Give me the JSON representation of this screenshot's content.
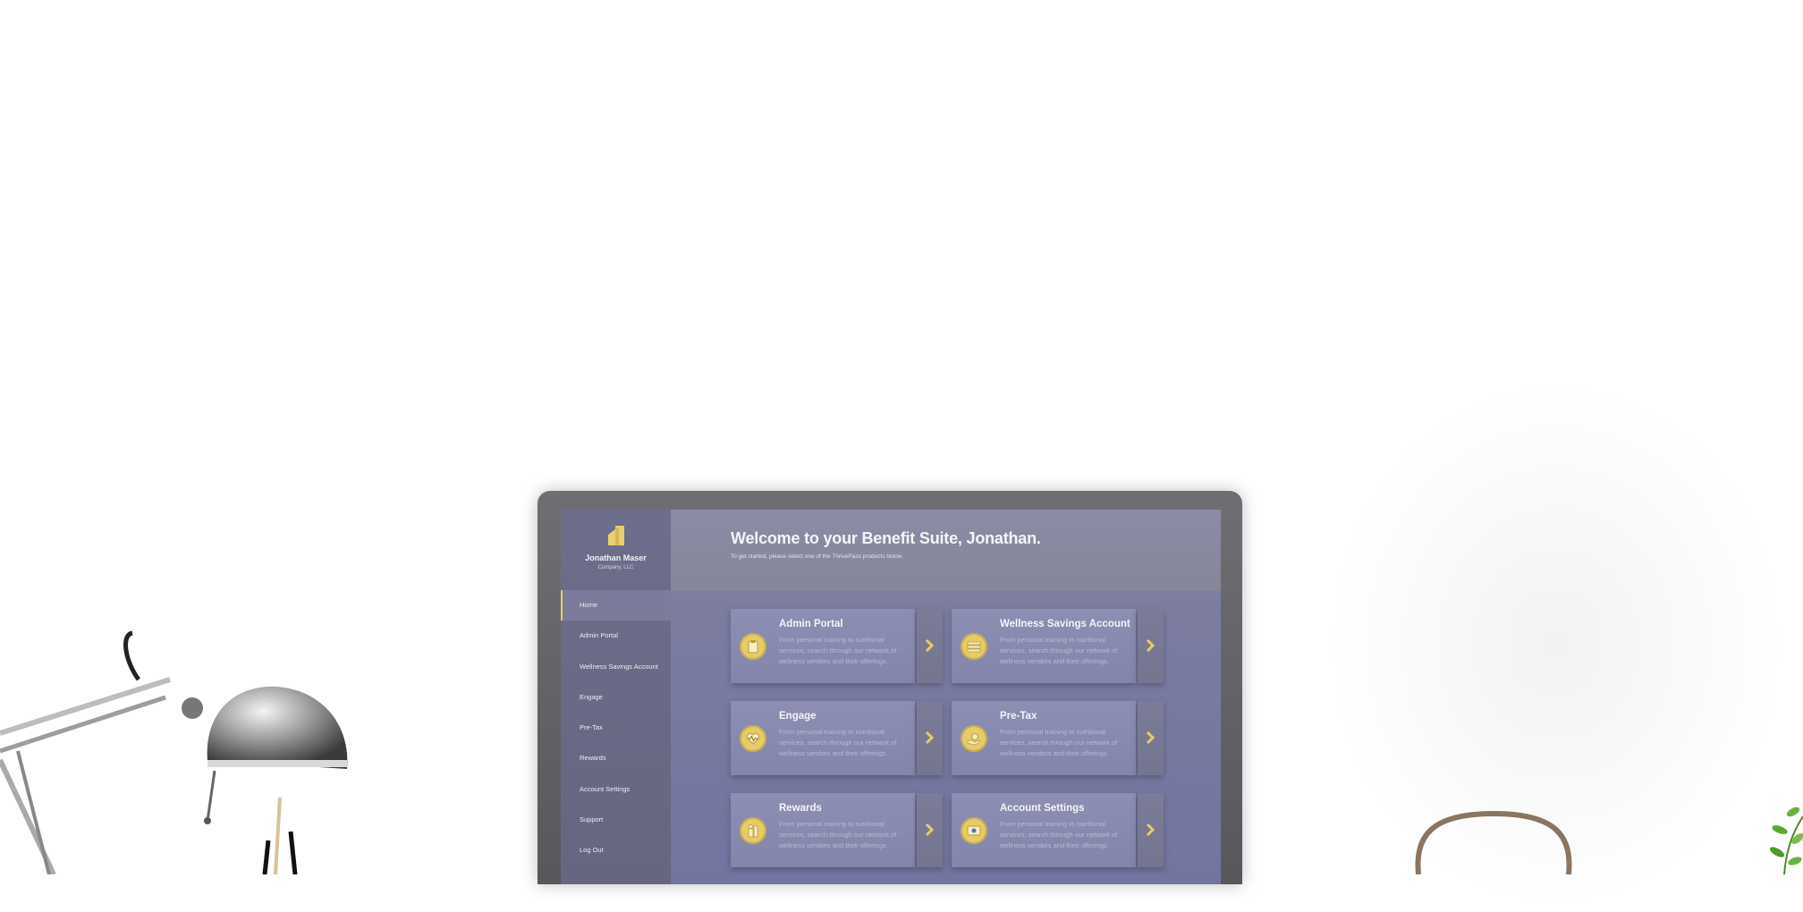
{
  "user": {
    "name": "Jonathan Maser",
    "company": "Company, LLC"
  },
  "sidebar": {
    "items": [
      {
        "label": "Home",
        "active": true
      },
      {
        "label": "Admin Portal",
        "active": false
      },
      {
        "label": "Wellness Savings Account",
        "active": false
      },
      {
        "label": "Engage",
        "active": false
      },
      {
        "label": "Pre-Tax",
        "active": false
      },
      {
        "label": "Rewards",
        "active": false
      },
      {
        "label": "Account Settings",
        "active": false
      },
      {
        "label": "Support",
        "active": false
      },
      {
        "label": "Log Out",
        "active": false
      }
    ]
  },
  "header": {
    "welcome": "Welcome to your Benefit Suite, Jonathan.",
    "subtitle": "To get started, please select one of the ThrivePass products below."
  },
  "cards": [
    {
      "title": "Admin Portal",
      "description": "From personal training to nutritional services, search through our network of wellness vendors and their offerings.",
      "icon": "clipboard-icon"
    },
    {
      "title": "Wellness Savings Account",
      "description": "From personal training to nutritional services, search through our network of wellness vendors and their offerings.",
      "icon": "card-stack-icon"
    },
    {
      "title": "Engage",
      "description": "From personal training to nutritional services, search through our network of wellness vendors and their offerings.",
      "icon": "heartbeat-icon"
    },
    {
      "title": "Pre-Tax",
      "description": "From personal training to nutritional services, search through our network of wellness vendors and their offerings.",
      "icon": "hand-coin-icon"
    },
    {
      "title": "Rewards",
      "description": "From personal training to nutritional services, search through our network of wellness vendors and their offerings.",
      "icon": "rewards-icon"
    },
    {
      "title": "Account Settings",
      "description": "From personal training to nutritional services, search through our network of wellness vendors and their offerings.",
      "icon": "id-card-icon"
    }
  ],
  "colors": {
    "accent": "#e6cc69",
    "sidebar": "#6d6e8c",
    "main": "#7a7ba0",
    "card": "#8d8eb3"
  }
}
